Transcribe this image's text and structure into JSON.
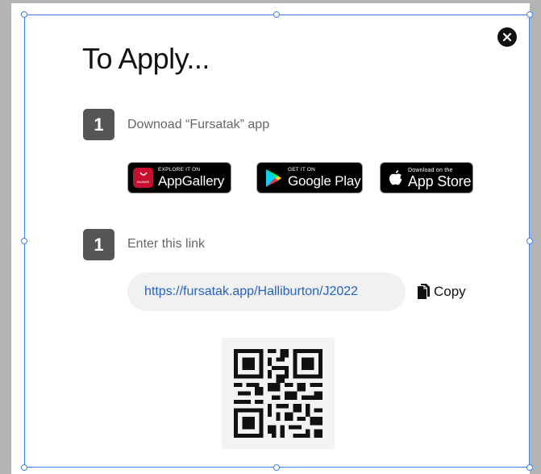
{
  "modal": {
    "title": "To Apply...",
    "close_icon": "close-icon"
  },
  "steps": [
    {
      "number": "1",
      "label": "Downoad “Fursatak” app"
    },
    {
      "number": "1",
      "label": "Enter this link"
    }
  ],
  "stores": [
    {
      "brand": "HUAWEI",
      "small": "EXPLORE IT ON",
      "big": "AppGallery",
      "icon": "huawei-appgallery-icon"
    },
    {
      "small": "GET IT ON",
      "big": "Google Play",
      "icon": "google-play-icon"
    },
    {
      "small": "Download on the",
      "big": "App Store",
      "icon": "apple-icon"
    }
  ],
  "link": {
    "url": "https://fursatak.app/Halliburton/J2022",
    "copy_label": "Copy",
    "copy_icon": "copy-icon"
  },
  "qr": {
    "icon": "qr-code-icon"
  },
  "colors": {
    "accent_link": "#2563c9",
    "selection": "#3b82f6",
    "badge": "#555555"
  }
}
